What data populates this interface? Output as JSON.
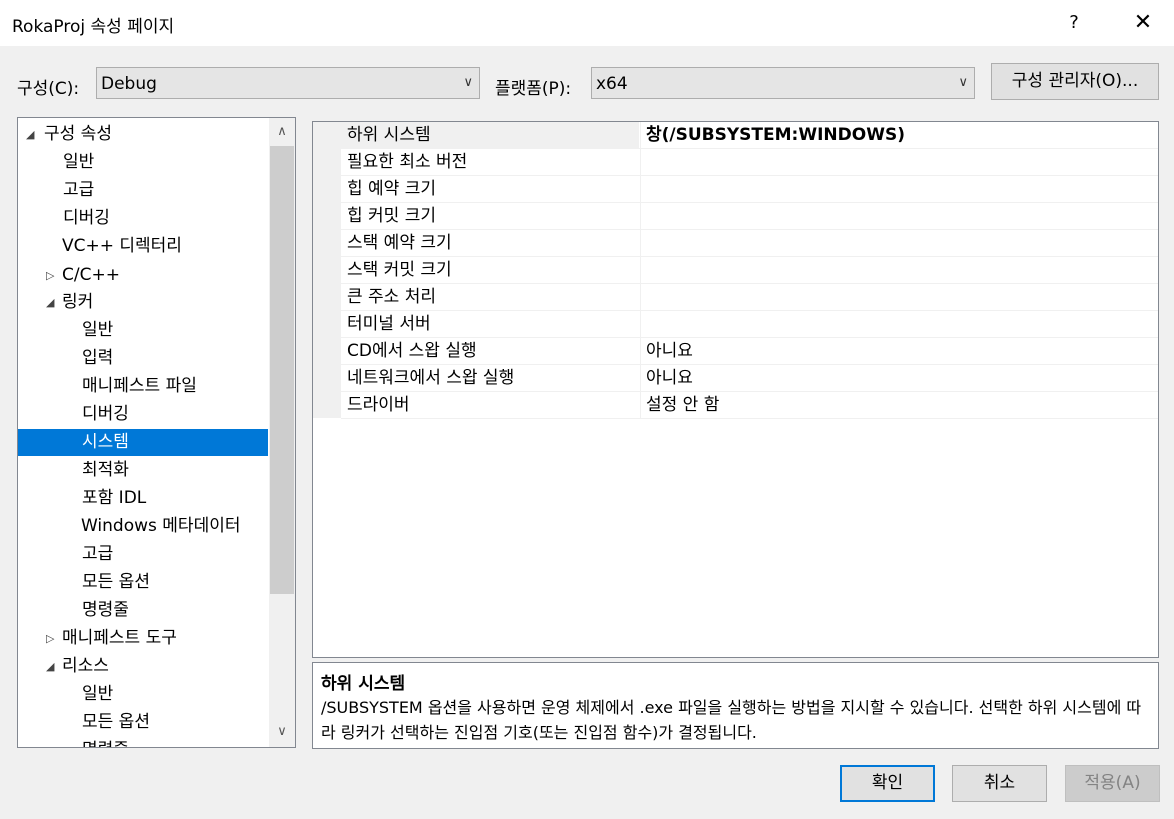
{
  "window": {
    "title": "RokaProj 속성 페이지",
    "help_label": "?",
    "close_label": "✕"
  },
  "config": {
    "label": "구성(C):",
    "value": "Debug"
  },
  "platform": {
    "label": "플랫폼(P):",
    "value": "x64"
  },
  "config_manager_label": "구성 관리자(O)...",
  "tree": {
    "items": [
      {
        "label": "구성 속성",
        "expander": "◢"
      },
      {
        "label": "일반"
      },
      {
        "label": "고급"
      },
      {
        "label": "디버깅"
      },
      {
        "label": "VC++ 디렉터리"
      },
      {
        "label": "C/C++",
        "expander": "▷"
      },
      {
        "label": "링커",
        "expander": "◢"
      },
      {
        "label": "일반"
      },
      {
        "label": "입력"
      },
      {
        "label": "매니페스트 파일"
      },
      {
        "label": "디버깅"
      },
      {
        "label": "시스템",
        "selected": true
      },
      {
        "label": "최적화"
      },
      {
        "label": "포함 IDL"
      },
      {
        "label": "Windows 메타데이터"
      },
      {
        "label": "고급"
      },
      {
        "label": "모든 옵션"
      },
      {
        "label": "명령줄"
      },
      {
        "label": "매니페스트 도구",
        "expander": "▷"
      },
      {
        "label": "리소스",
        "expander": "◢"
      },
      {
        "label": "일반"
      },
      {
        "label": "모든 옵션"
      },
      {
        "label": "명령줄"
      }
    ]
  },
  "properties": [
    {
      "name": "하위 시스템",
      "value": "창(/SUBSYSTEM:WINDOWS)",
      "selected": true
    },
    {
      "name": "필요한 최소 버전",
      "value": ""
    },
    {
      "name": "힙 예약 크기",
      "value": ""
    },
    {
      "name": "힙 커밋 크기",
      "value": ""
    },
    {
      "name": "스택 예약 크기",
      "value": ""
    },
    {
      "name": "스택 커밋 크기",
      "value": ""
    },
    {
      "name": "큰 주소 처리",
      "value": ""
    },
    {
      "name": "터미널 서버",
      "value": ""
    },
    {
      "name": "CD에서 스왑 실행",
      "value": "아니요"
    },
    {
      "name": "네트워크에서 스왑 실행",
      "value": "아니요"
    },
    {
      "name": "드라이버",
      "value": "설정 안 함"
    }
  ],
  "description": {
    "title": "하위 시스템",
    "text": "/SUBSYSTEM 옵션을 사용하면 운영 체제에서 .exe 파일을 실행하는 방법을 지시할 수 있습니다. 선택한 하위 시스템에 따라 링커가 선택하는 진입점 기호(또는 진입점 함수)가 결정됩니다."
  },
  "buttons": {
    "ok": "확인",
    "cancel": "취소",
    "apply": "적용(A)"
  },
  "colors": {
    "selection": "#0078d7",
    "background": "#f0f0f0"
  }
}
